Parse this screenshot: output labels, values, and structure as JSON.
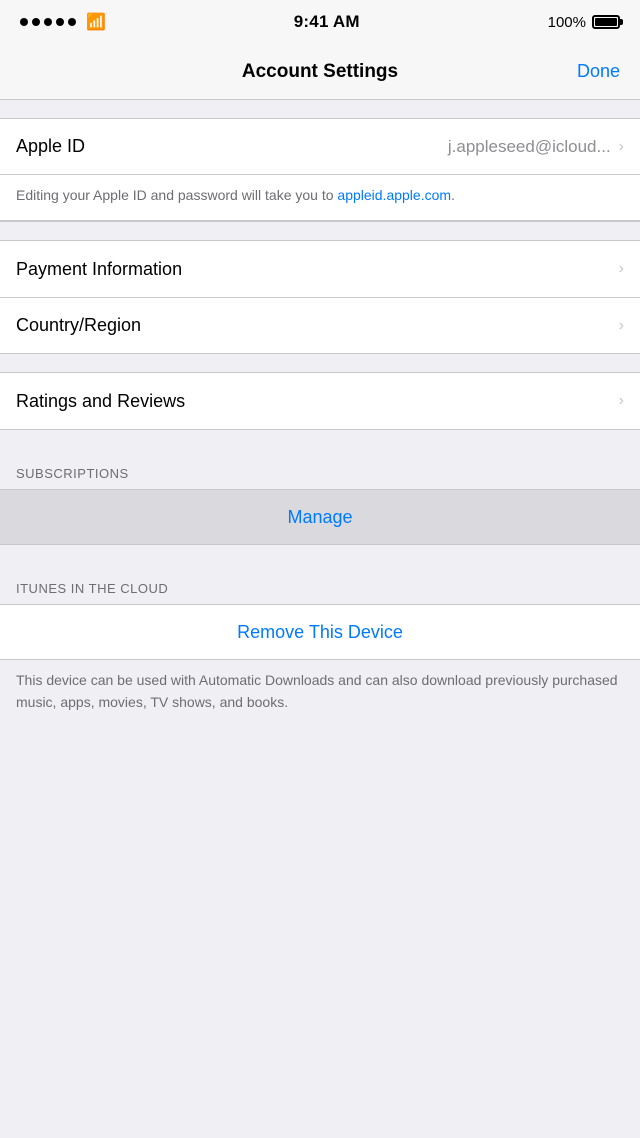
{
  "statusBar": {
    "time": "9:41 AM",
    "batteryPercent": "100%",
    "signalDots": 5
  },
  "navBar": {
    "title": "Account Settings",
    "doneLabel": "Done"
  },
  "appleId": {
    "label": "Apple ID",
    "value": "j.appleseed@icloud...",
    "description1": "Editing your Apple ID and password will take you to ",
    "linkText": "appleid.apple.com",
    "description2": "."
  },
  "menuItems": [
    {
      "label": "Payment Information"
    },
    {
      "label": "Country/Region"
    }
  ],
  "ratingsRow": {
    "label": "Ratings and Reviews"
  },
  "subscriptions": {
    "sectionHeader": "SUBSCRIPTIONS",
    "manageLabel": "Manage"
  },
  "itunesCloud": {
    "sectionHeader": "iTUNES IN THE CLOUD",
    "removeLabel": "Remove This Device",
    "footerText": "This device can be used with Automatic Downloads and can also download previously purchased music, apps, movies, TV shows, and books."
  }
}
